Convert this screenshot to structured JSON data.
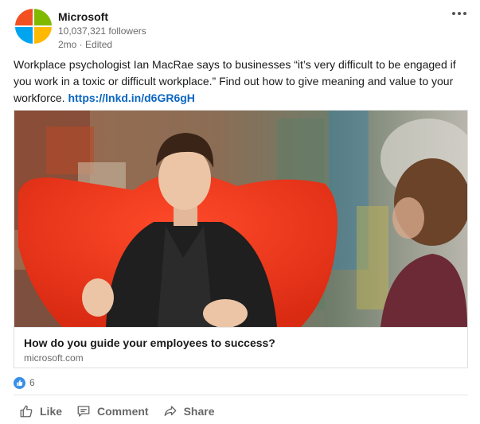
{
  "author": {
    "name": "Microsoft",
    "followers": "10,037,321 followers",
    "time": "2mo",
    "edited": "Edited",
    "logo_colors": [
      "#f25022",
      "#7fba00",
      "#00a4ef",
      "#ffb900"
    ]
  },
  "post": {
    "text": "Workplace psychologist Ian MacRae says to businesses “it’s very difficult to be engaged if you work in a toxic or difficult workplace.” Find out how to give meaning and value to your workforce. ",
    "link": "https://lnkd.in/d6GR6gH"
  },
  "article": {
    "title": "How do you guide your employees to success?",
    "domain": "microsoft.com"
  },
  "social": {
    "reaction_count": "6",
    "reaction_icon": "like-icon"
  },
  "actions": [
    {
      "label": "Like",
      "icon": "thumbs-up-icon"
    },
    {
      "label": "Comment",
      "icon": "comment-icon"
    },
    {
      "label": "Share",
      "icon": "share-icon"
    }
  ],
  "colors": {
    "link": "#0a66c2",
    "like_blue": "#378fe9",
    "chair_red": "#e8331c"
  }
}
